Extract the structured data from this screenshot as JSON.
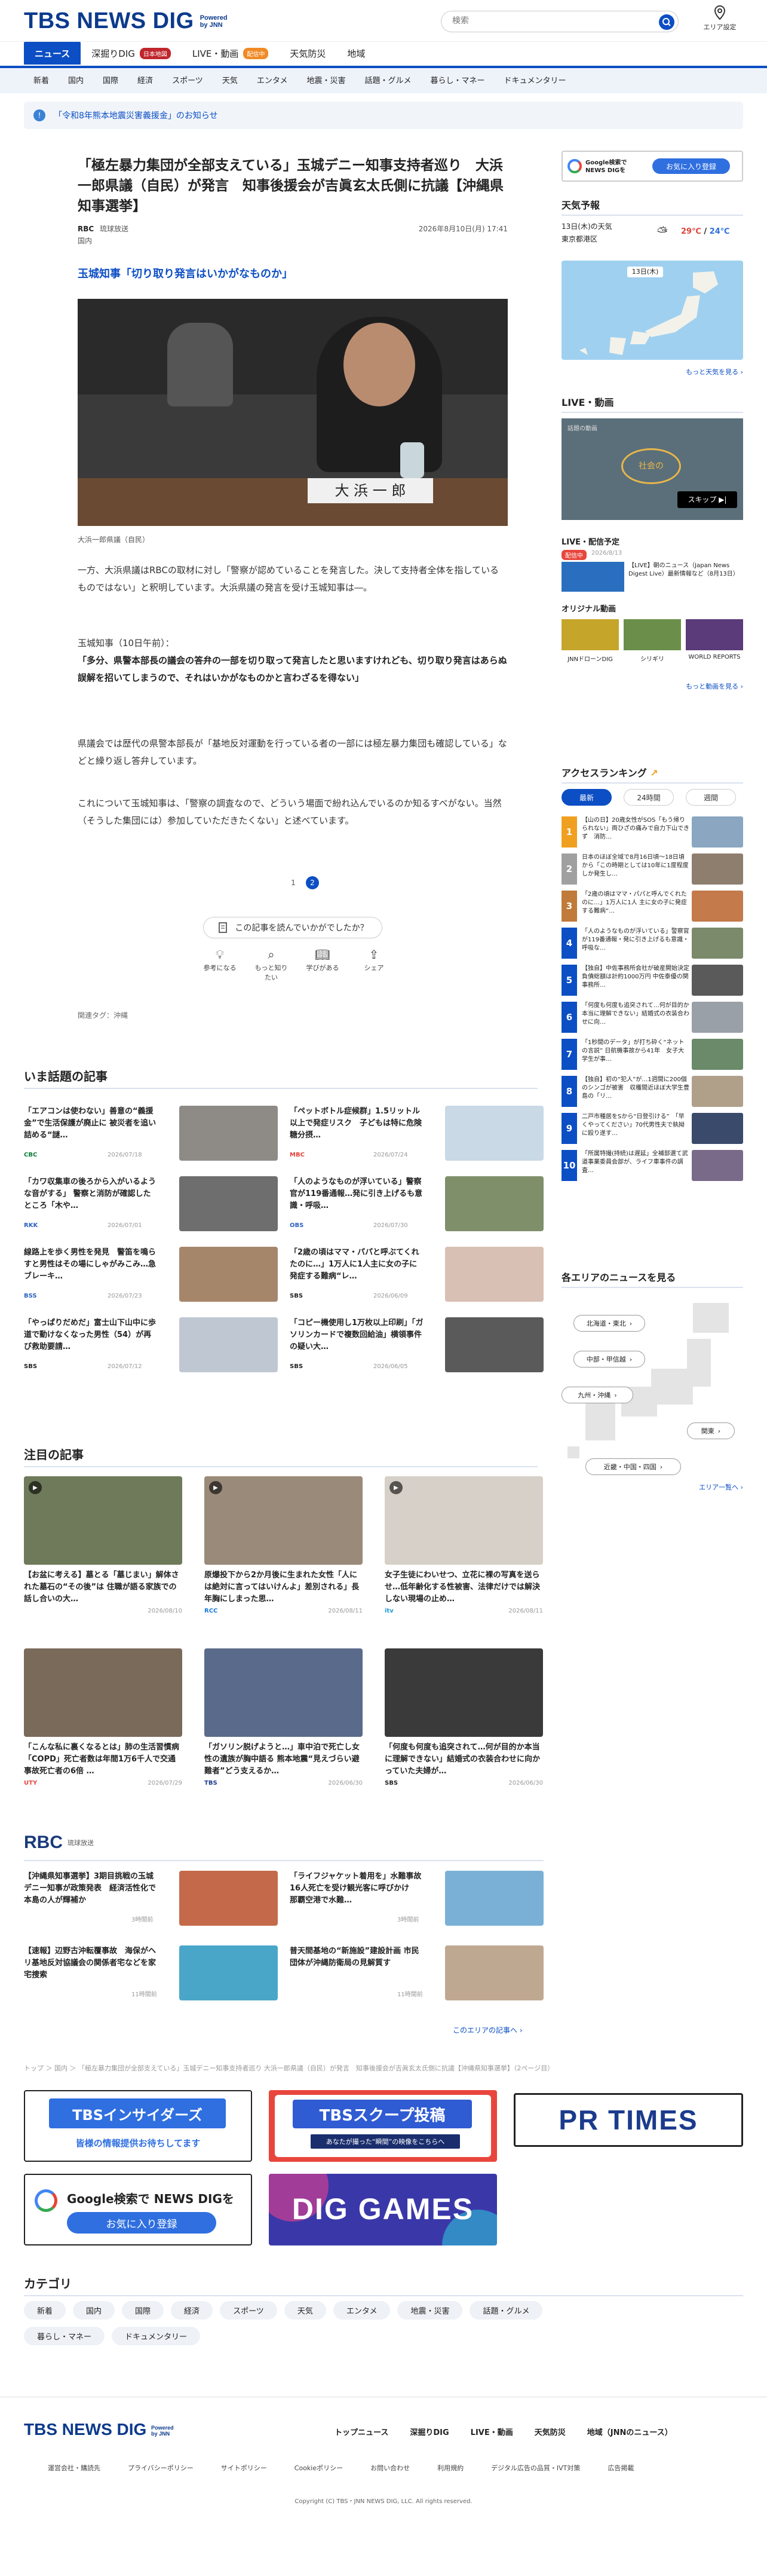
{
  "header": {
    "logo": "TBS NEWS DIG",
    "powered": "Powered by JNN",
    "search_placeholder": "検索",
    "area_label": "エリア設定"
  },
  "gnav": [
    {
      "label": "ニュース"
    },
    {
      "label": "深掘りDIG",
      "badge": "日本地図"
    },
    {
      "label": "LIVE・動画",
      "badge": "配信中"
    },
    {
      "label": "天気防災"
    },
    {
      "label": "地域"
    }
  ],
  "subnav": [
    "新着",
    "国内",
    "国際",
    "経済",
    "スポーツ",
    "天気",
    "エンタメ",
    "地震・災害",
    "話題・グルメ",
    "暮らし・マネー",
    "ドキュメンタリー"
  ],
  "notice": {
    "text": "「令和8年熊本地震災害義援金」のお知らせ"
  },
  "article": {
    "title": "「極左暴力集団が全部支えている」玉城デニー知事支持者巡り　大浜一郎県議（自民）が発言　知事後援会が吉眞玄太氏側に抗議【沖縄県知事選挙】",
    "source": "RBC",
    "source_name": "琉球放送",
    "date": "2026年8月10日(月) 17:41",
    "category": "国内",
    "subhead": "玉城知事「切り取り発言はいかがなものか」",
    "photo_name_plate": "大 浜 一 郎",
    "caption": "大浜一郎県議（自民）",
    "p1": "一方、大浜県議はRBCの取材に対し「警察が認めていることを発言した。決して支持者全体を指しているものではない」と釈明しています。大浜県議の発言を受け玉城知事は―。",
    "p2a": "玉城知事（10日午前）：",
    "p2b": "「多分、県警本部長の議会の答弁の一部を切り取って発言したと思いますけれども、切り取り発言はあらぬ誤解を招いてしまうので、それはいかがなものかと言わざるを得ない」",
    "p3": "県議会では歴代の県警本部長が「基地反対運動を行っている者の一部には極左暴力集団も確認している」などと繰り返し答弁しています。",
    "p4": "これについて玉城知事は、「警察の調査なので、どういう場面で紛れ込んでいるのか知るすべがない。当然（そうした集団には）参加していただきたくない」と述べています。",
    "pages": [
      "1",
      "2"
    ],
    "react_q": "この記事を読んでいかがでしたか？",
    "reacts": [
      "参考になる",
      "もっと知りたい",
      "学びがある",
      "シェア"
    ],
    "tags": "関連タグ：",
    "tag1": "沖縄"
  },
  "wadai": {
    "title": "いま話題の記事",
    "items": [
      {
        "text": "「エアコンは使わない」善意の“義援金”で生活保護が廃止に 被災者を追い詰める“謎…",
        "src": "CBC",
        "date": "2026/07/18"
      },
      {
        "text": "「ペットボトル症候群」1.5リットル以上で発症リスク　子どもは特に危険　糖分摂…",
        "src": "MBC",
        "date": "2026/07/24"
      },
      {
        "text": "「カワ収集車の後ろから入がいるような音がする」 警察と消防が確認したところ「木や…",
        "src": "RKK",
        "date": "2026/07/01"
      },
      {
        "text": "「人のようなものが浮いている」警察官が119番通報…発に引き上げるも意識・呼吸…",
        "src": "OBS",
        "date": "2026/07/30"
      },
      {
        "text": "線路上を歩く男性を発見　警笛を鳴らすと男性はその場にしゃがみこみ…急ブレーキ…",
        "src": "BSS",
        "date": "2026/07/23"
      },
      {
        "text": "「2歳の頃はママ・パパと呼ぶてくれたのに…」1万人に1人主に女の子に発症する難病“レ…",
        "src": "SBS",
        "date": "2026/06/09"
      },
      {
        "text": "「やっぱりだめだ」富士山下山中に歩道で動けなくなった男性（54）が再び救助要請…",
        "src": "SBS",
        "date": "2026/07/12"
      },
      {
        "text": "「コピー機使用し1万枚以上印刷」「ガソリンカードで複数回給油」横領事件の疑い大…",
        "src": "SBS",
        "date": "2026/06/05"
      }
    ]
  },
  "chumoku": {
    "title": "注目の記事",
    "items": [
      {
        "text": "【お盆に考える】墓とる「墓じまい」解体された墓石の“その後”は 住職が語る家族での話し合いの大…",
        "src": "",
        "date": "2026/08/10"
      },
      {
        "text": "原爆投下から2か月後に生まれた女性「人には絶対に言ってはいけんよ」差別される」長年胸にしまった思…",
        "src": "RCC",
        "date": "2026/08/11"
      },
      {
        "text": "女子生徒にわいせつ、立花に裸の写真を送らせ…低年齢化する性被害、法律だけでは解決しない現場の止め…",
        "src": "itv",
        "date": "2026/08/11"
      },
      {
        "text": "「こんな私に裏くなるとは」肺の生活習慣病「COPD」死亡者数は年間1万6千人で交通事故死亡者の6倍 …",
        "src": "UTY",
        "date": "2026/07/29"
      },
      {
        "text": "「ガソリン脱げようと…」車中泊で死亡し女性の遺族が胸中語る 熊本地震“見えづらい避難者”どう支えるか…",
        "src": "TBS",
        "date": "2026/06/30"
      },
      {
        "text": "「何度も何度も追突されて…何が目的か本当に理解できない」結婚式の衣装合わせに向かっていた夫婦が…",
        "src": "SBS",
        "date": "2026/06/30"
      }
    ]
  },
  "rbc": {
    "logo": "RBC",
    "label": "琉球放送",
    "items": [
      {
        "text": "【沖縄県知事選挙】3期目挑戦の玉城デニー知事が政策発表　経済活性化で本島の人が輝補か",
        "date": "3時間前"
      },
      {
        "text": "「ライフジャケット着用を」水難事故16人死亡を受け観光客に呼びかけ　那覇空港で水難…",
        "date": "3時間前"
      },
      {
        "text": "【速報】辺野古沖転覆事故　海保がヘリ基地反対協議会の関係者宅などを家宅捜索",
        "date": "11時間前"
      },
      {
        "text": "普天間基地の“新施設”建設計画 市民団体が沖縄防衛局の見解質す",
        "date": "11時間前"
      }
    ],
    "more": "このエリアの記事へ ›"
  },
  "breadcrumb": "トップ ＞ 国内 ＞ 「極左暴力集団が全部支えている」玉城デニー知事支持者巡り 大浜一郎県議（自民）が発言　知事後援会が吉眞玄太氏側に抗議【沖縄県知事選挙】（2ページ目）",
  "banners": {
    "insider_title": "TBSインサイダーズ",
    "insider_sub": "皆様の情報提供お待ちしてます",
    "scoop_title": "TBSスクープ投稿",
    "scoop_sub": "あなたが撮った“瞬間”の映像をこちらへ",
    "prtimes": "PR TIMES",
    "google_title": "Google検索で NEWS DIGを",
    "google_btn": "お気に入り登録",
    "games": "DIG GAMES"
  },
  "categories": {
    "title": "カテゴリ",
    "items": [
      "新着",
      "国内",
      "国際",
      "経済",
      "スポーツ",
      "天気",
      "エンタメ",
      "地震・災害",
      "話題・グルメ",
      "暮らし・マネー",
      "ドキュメンタリー"
    ]
  },
  "footer": {
    "logo": "TBS NEWS DIG",
    "powered": "Powered by JNN",
    "nav": [
      "トップニュース",
      "深掘りDIG",
      "LIVE・動画",
      "天気防災",
      "地域（JNNのニュース）"
    ],
    "links": [
      "運営会社・購読先",
      "プライバシーポリシー",
      "サイトポリシー",
      "Cookieポリシー",
      "お問い合わせ",
      "利用規約",
      "デジタル広告の品質・IVT対策",
      "広告掲載"
    ],
    "copyright": "Copyright (C) TBS・JNN NEWS DIG, LLC. All rights reserved."
  },
  "side": {
    "google_label": "Google検索で NEWS DIGを",
    "google_btn": "お気に入り登録",
    "weather_title": "天気予報",
    "weather_date": "13日(木)の天気",
    "weather_place": "東京都港区",
    "weather_hi": "29℃",
    "weather_lo": "24℃",
    "weather_map_title": "13日(木)",
    "weather_more": "もっと天気を見る ›",
    "live_title": "LIVE・動画",
    "live_video_label": "話題の動画",
    "live_skip": "スキップ ▶|",
    "live_video_sub": "社会の",
    "live_now_title": "LIVE・配信予定",
    "live_badge": "配信中",
    "live_date": "2026/8/13",
    "live_item_text": "【LIVE】朝のニュース（Japan News Digest Live）最新情報など（8月13日）",
    "original_title": "オリジナル動画",
    "orig": [
      "JNNドローンDIG",
      "シリギリ",
      "WORLD REPORTS"
    ],
    "original_more": "もっと動画を見る ›",
    "rank_title": "アクセスランキング",
    "rank_tabs": [
      "最新",
      "24時間",
      "週間"
    ],
    "rank": [
      "【山の日】20歳女性がSOS「もう帰りられない」両ひざの痛みで自力下山できず　消防…",
      "日本のほぼ全域で8月16日頃～18日頃から「この時期としては10年に1度程度しか発生し…",
      "「2歳の頃はママ・パパと呼んでくれたのに…」1万人に1人 主に女の子に発症する難病“…",
      "「人のようなものが浮いている」警察官が119番通報・発に引き上げるも意識・呼吸な…",
      "【独自】中佐事務所会社が破産開始決定 負債総額は計約1000万円 中佐泰優の関事務所…",
      "「何度も何度も追突されて…何が目的か本当に理解できない」結婚式の衣装合わせに向…",
      "「1秒間のデータ」が打ち砕く“ネットの言説” 日航機事故から41年　女子大学生が事…",
      "【独自】初の“犯人”が…1週間に200個のシンゴが被害　収穫間近ほぼ大学生豊島の「リ…",
      "二戸市種居をSから“日登引ける”　「早くやってください」70代男性夫で執拗に殴り遂す…",
      "「所属特撮(持続)は遅延」全補部選て武道事業委員会部が、ライフ車事件の調査…"
    ],
    "area_title": "各エリアのニュースを見る",
    "area_labels": [
      "北海道・東北",
      "中部・甲信越",
      "九州・沖縄",
      "関東",
      "近畿・中国・四国"
    ],
    "area_more": "エリア一覧へ ›"
  }
}
